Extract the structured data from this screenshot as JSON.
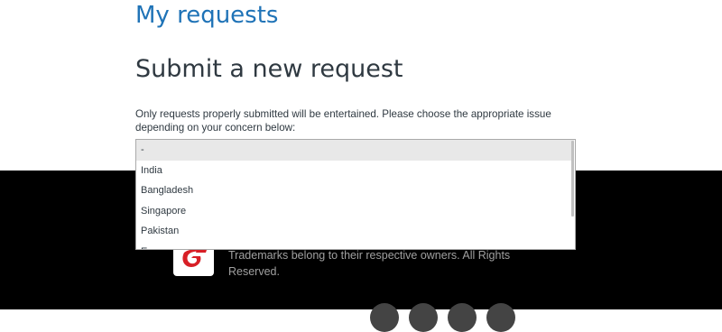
{
  "header": {
    "my_requests": "My requests",
    "title": "Submit a new request"
  },
  "intro": "Only requests properly submitted will be entertained. Please choose the appropriate issue depending on your concern below:",
  "dropdown": {
    "options": [
      "-",
      "India",
      "Bangladesh",
      "Singapore",
      "Pakistan",
      "Europe"
    ],
    "selected": "-"
  },
  "footer": {
    "text": "Trademarks belong to their respective owners. All Rights Reserved."
  },
  "colors": {
    "link": "#1f73b7",
    "footer_bg": "#000000",
    "logo_red": "#d81f26"
  }
}
